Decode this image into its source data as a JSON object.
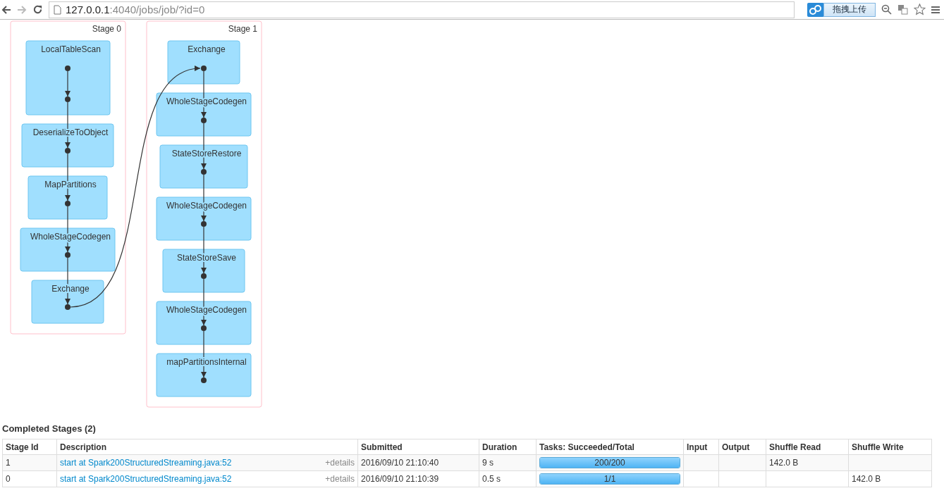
{
  "browser": {
    "url_host": "127.0.0.1",
    "url_path": ":4040/jobs/job/?id=0",
    "upload_button": "拖拽上传"
  },
  "dag": {
    "stages": [
      {
        "title": "Stage 0",
        "nodes": [
          {
            "label": "LocalTableScan"
          },
          {
            "label": "DeserializeToObject"
          },
          {
            "label": "MapPartitions"
          },
          {
            "label": "WholeStageCodegen"
          },
          {
            "label": "Exchange"
          }
        ]
      },
      {
        "title": "Stage 1",
        "nodes": [
          {
            "label": "Exchange"
          },
          {
            "label": "WholeStageCodegen"
          },
          {
            "label": "StateStoreRestore"
          },
          {
            "label": "WholeStageCodegen"
          },
          {
            "label": "StateStoreSave"
          },
          {
            "label": "WholeStageCodegen"
          },
          {
            "label": "mapPartitionsInternal"
          }
        ]
      }
    ]
  },
  "completed_stages": {
    "title": "Completed Stages (2)",
    "columns": [
      "Stage Id",
      "Description",
      "Submitted",
      "Duration",
      "Tasks: Succeeded/Total",
      "Input",
      "Output",
      "Shuffle Read",
      "Shuffle Write"
    ],
    "rows": [
      {
        "stage_id": "1",
        "description": "start at Spark200StructuredStreaming.java:52",
        "details": "+details",
        "submitted": "2016/09/10 21:10:40",
        "duration": "9 s",
        "tasks": "200/200",
        "level": 1,
        "shuffle_read": "142.0 B"
      },
      {
        "stage_id": "0",
        "description": "start at Spark200StructuredStreaming.java:52",
        "details": "+details",
        "submitted": "2016/09/10 21:10:39",
        "duration": "0.5 s",
        "tasks": "1/1",
        "level": 1,
        "shuffle_write": "142.0 B"
      }
    ]
  }
}
